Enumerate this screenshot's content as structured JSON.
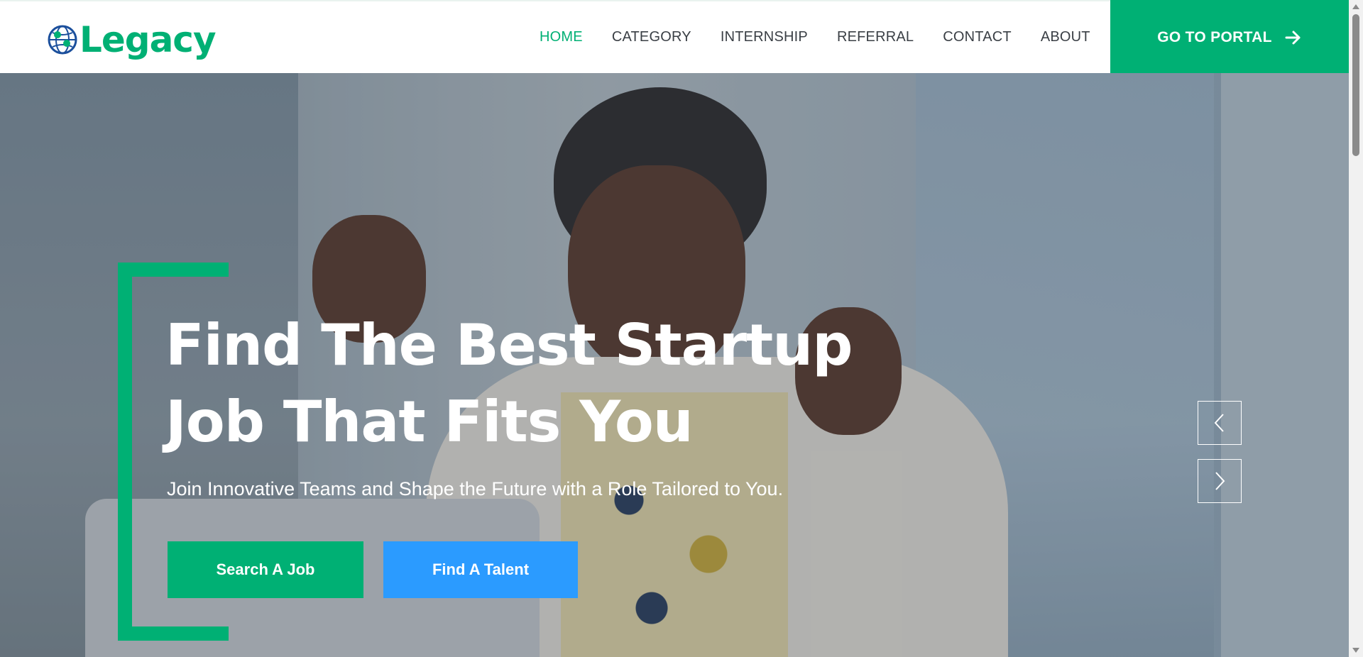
{
  "brand": {
    "name": "Legacy",
    "logo_icon": "globe-icon",
    "color": "#00b074"
  },
  "nav": {
    "items": [
      {
        "label": "HOME",
        "active": true
      },
      {
        "label": "CATEGORY",
        "active": false
      },
      {
        "label": "INTERNSHIP",
        "active": false
      },
      {
        "label": "REFERRAL",
        "active": false
      },
      {
        "label": "CONTACT",
        "active": false
      },
      {
        "label": "ABOUT",
        "active": false
      }
    ],
    "portal_button": {
      "label": "GO TO PORTAL",
      "icon": "arrow-right-icon"
    }
  },
  "hero": {
    "headline_line1": "Find The Best Startup",
    "headline_line2": "Job That Fits You",
    "subline": "Join Innovative Teams and Shape the Future with a Role Tailored to You.",
    "primary_button": "Search A Job",
    "secondary_button": "Find A Talent",
    "prev_icon": "chevron-left-icon",
    "next_icon": "chevron-right-icon"
  },
  "colors": {
    "accent": "#00b074",
    "secondary": "#2b9bff",
    "text_dark": "#3a3f45"
  }
}
